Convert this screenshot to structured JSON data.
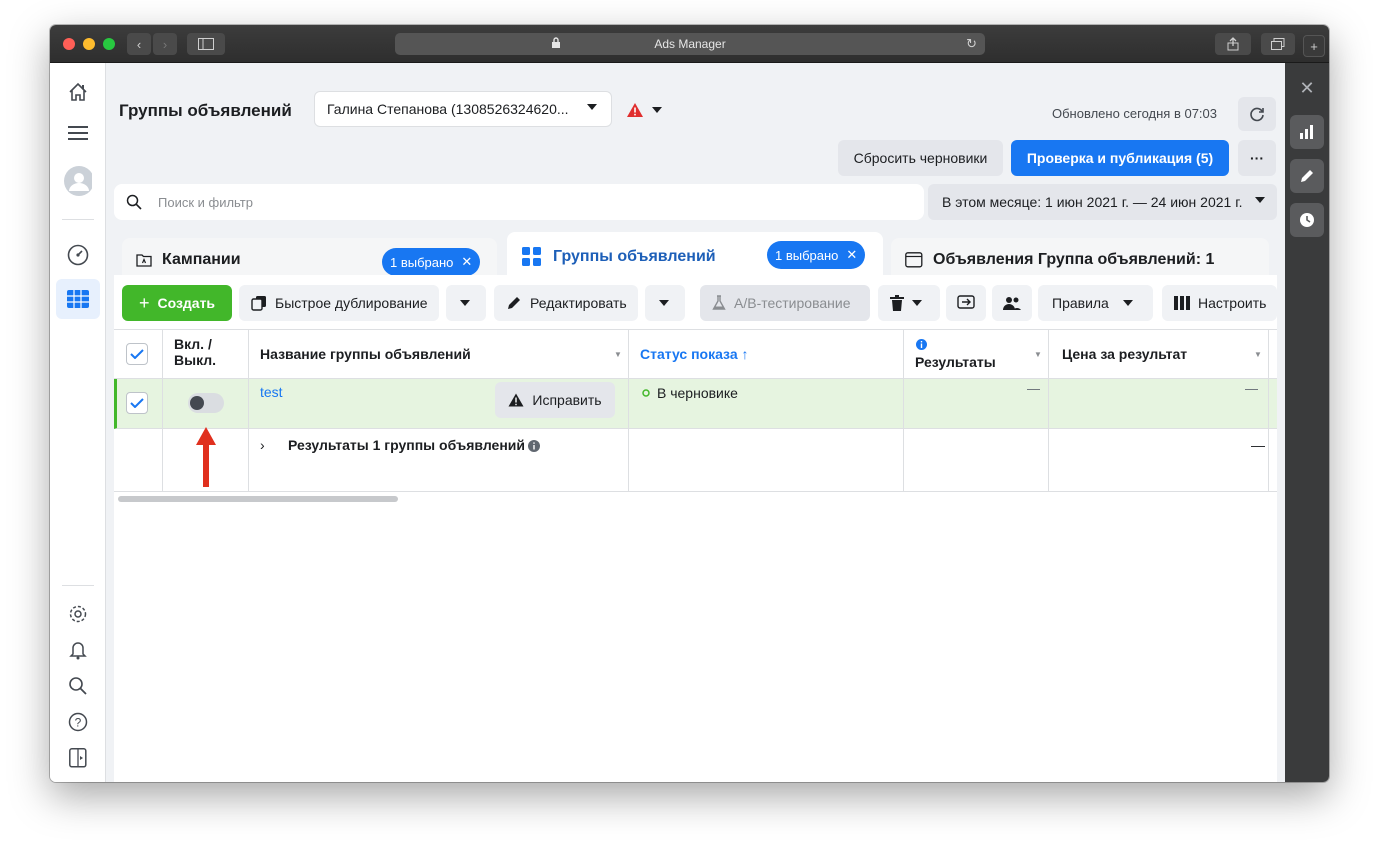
{
  "browser": {
    "title": "Ads Manager",
    "nav_back": "‹",
    "nav_forward": "›"
  },
  "header": {
    "page_title": "Группы объявлений",
    "account": "Галина Степанова (1308526324620...",
    "updated": "Обновлено сегодня в 07:03",
    "discard_drafts": "Сбросить черновики",
    "review_publish": "Проверка и публикация (5)",
    "more": "···"
  },
  "search": {
    "placeholder": "Поиск и фильтр",
    "date_range": "В этом месяце: 1 июн 2021 г. — 24 июн 2021 г."
  },
  "tabs": [
    {
      "label": "Кампании",
      "chip": "1 выбрано"
    },
    {
      "label": "Группы объявлений",
      "chip": "1 выбрано"
    },
    {
      "label": "Объявления Группа объявлений: 1"
    }
  ],
  "toolbar": {
    "create": "Создать",
    "quick_duplicate": "Быстрое дублирование",
    "edit": "Редактировать",
    "ab_test": "A/B-тестирование",
    "rules": "Правила",
    "customize": "Настроить"
  },
  "table": {
    "headers": {
      "onoff": "Вкл. / Выкл.",
      "name": "Название группы объявлений",
      "status": "Статус показа ↑",
      "results": "Результаты",
      "cost": "Цена за результат"
    },
    "row": {
      "name": "test",
      "fix": "Исправить",
      "status": "В черновике",
      "results": "—",
      "cost": "—"
    },
    "summary": {
      "label": "Результаты 1 группы объявлений",
      "cost": "—"
    }
  },
  "colors": {
    "accent": "#1877f2",
    "create": "#42b72a",
    "selected_row": "#e6f4e0",
    "arrow": "#e0301e"
  }
}
